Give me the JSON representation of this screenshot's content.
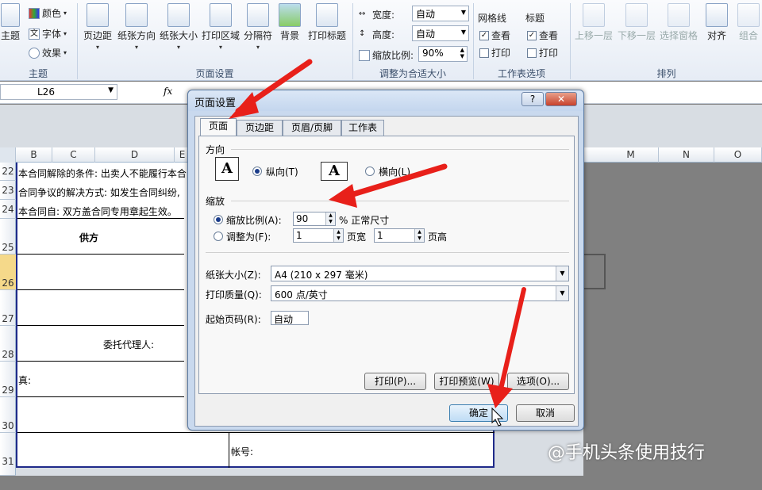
{
  "ribbon": {
    "theme_items": {
      "colors": "颜色",
      "fonts": "字体",
      "effects": "效果",
      "theme_label": "主题"
    },
    "buttons": [
      "页边距",
      "纸张方向",
      "纸张大小",
      "打印区域",
      "分隔符",
      "背景",
      "打印标题"
    ],
    "groups": {
      "theme": "主题",
      "page_setup": "页面设置",
      "scale_to_fit": "调整为合适大小",
      "sheet_options": "工作表选项",
      "arrange": "排列"
    },
    "scale": {
      "width_label": "宽度:",
      "width_value": "自动",
      "height_label": "高度:",
      "height_value": "自动",
      "scale_label": "缩放比例:",
      "scale_value": "90%"
    },
    "sheet_options": {
      "gridlines": "网格线",
      "headings": "标题",
      "view": "查看",
      "print": "打印"
    },
    "arrange": [
      "上移一层",
      "下移一层",
      "选择窗格",
      "对齐",
      "组合"
    ]
  },
  "formula_bar": {
    "name_box": "L26",
    "fx": "fx"
  },
  "columns": [
    "B",
    "C",
    "D",
    "E",
    "M",
    "N",
    "O"
  ],
  "rows": [
    "22",
    "23",
    "24",
    "25",
    "26",
    "27",
    "28",
    "29",
    "30",
    "31"
  ],
  "sheet": {
    "r22": "本合同解除的条件: 出卖人不能履行本合",
    "r23": "合同争议的解决方式: 如发生合同纠纷,",
    "r24": "本合同自: 双方盖合同专用章起生效。",
    "supplier": "供方",
    "agent": "委托代理人:",
    "fax": "真:",
    "account": "帐号:"
  },
  "dialog": {
    "title": "页面设置",
    "help": "?",
    "tabs": [
      "页面",
      "页边距",
      "页眉/页脚",
      "工作表"
    ],
    "orientation_label": "方向",
    "portrait": "纵向(T)",
    "landscape": "横向(L)",
    "scaling_label": "缩放",
    "adjust_to": "缩放比例(A):",
    "adjust_value": "90",
    "normal_size": "% 正常尺寸",
    "fit_to": "调整为(F):",
    "fit_wide_value": "1",
    "fit_wide_label": "页宽",
    "fit_tall_value": "1",
    "fit_tall_label": "页高",
    "paper_size_label": "纸张大小(Z):",
    "paper_size_value": "A4 (210 x 297 毫米)",
    "print_quality_label": "打印质量(Q):",
    "print_quality_value": "600 点/英寸",
    "first_page_label": "起始页码(R):",
    "first_page_value": "自动",
    "print_btn": "打印(P)...",
    "preview_btn": "打印预览(W)",
    "options_btn": "选项(O)...",
    "ok_btn": "确定",
    "cancel_btn": "取消"
  },
  "watermark": "@手机头条使用技行",
  "colors": {
    "arrow": "#e8201a",
    "border": "#1f2a8a"
  }
}
